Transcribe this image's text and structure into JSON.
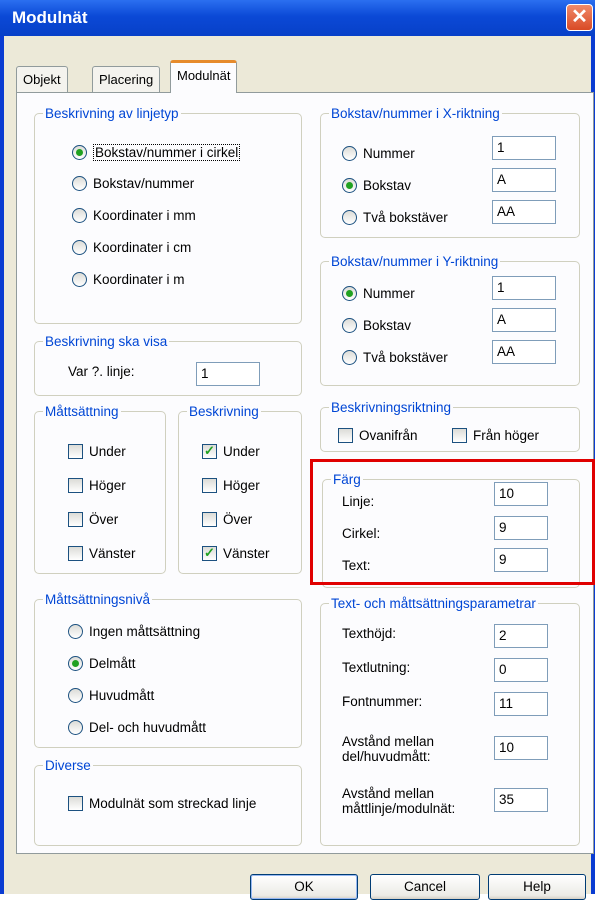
{
  "window": {
    "title": "Modulnät",
    "close_glyph": "✕"
  },
  "tabs": [
    {
      "label": "Objekt"
    },
    {
      "label": "Placering"
    },
    {
      "label": "Modulnät"
    }
  ],
  "beskrivning_linjetyp": {
    "legend": "Beskrivning av linjetyp",
    "options": [
      "Bokstav/nummer i cirkel",
      "Bokstav/nummer",
      "Koordinater i mm",
      "Koordinater i cm",
      "Koordinater i m"
    ],
    "selected": "Bokstav/nummer i cirkel"
  },
  "x_riktning": {
    "legend": "Bokstav/nummer i X-riktning",
    "options": [
      {
        "label": "Nummer",
        "value": "1"
      },
      {
        "label": "Bokstav",
        "value": "A"
      },
      {
        "label": "Två bokstäver",
        "value": "AA"
      }
    ],
    "selected": "Bokstav"
  },
  "y_riktning": {
    "legend": "Bokstav/nummer i Y-riktning",
    "options": [
      {
        "label": "Nummer",
        "value": "1"
      },
      {
        "label": "Bokstav",
        "value": "A"
      },
      {
        "label": "Två bokstäver",
        "value": "AA"
      }
    ],
    "selected": "Nummer"
  },
  "beskrivning_visa": {
    "legend": "Beskrivning ska visa",
    "label": "Var ?. linje:",
    "value": "1"
  },
  "beskrivningsriktning": {
    "legend": "Beskrivningsriktning",
    "options": [
      {
        "label": "Ovanifrån",
        "checked": false
      },
      {
        "label": "Från höger",
        "checked": false
      }
    ]
  },
  "mattsattning": {
    "legend": "Måttsättning",
    "options": [
      {
        "label": "Under",
        "checked": false
      },
      {
        "label": "Höger",
        "checked": false
      },
      {
        "label": "Över",
        "checked": false
      },
      {
        "label": "Vänster",
        "checked": false
      }
    ]
  },
  "beskrivning": {
    "legend": "Beskrivning",
    "options": [
      {
        "label": "Under",
        "checked": true
      },
      {
        "label": "Höger",
        "checked": false
      },
      {
        "label": "Över",
        "checked": false
      },
      {
        "label": "Vänster",
        "checked": true
      }
    ]
  },
  "farg": {
    "legend": "Färg",
    "fields": [
      {
        "label": "Linje:",
        "value": "10"
      },
      {
        "label": "Cirkel:",
        "value": "9"
      },
      {
        "label": "Text:",
        "value": "9"
      }
    ]
  },
  "mattsattningsniva": {
    "legend": "Måttsättningsnivå",
    "options": [
      "Ingen måttsättning",
      "Delmått",
      "Huvudmått",
      "Del- och huvudmått"
    ],
    "selected": "Delmått"
  },
  "text_parametrar": {
    "legend": "Text- och måttsättningsparametrar",
    "fields": [
      {
        "label": "Texthöjd:",
        "value": "2"
      },
      {
        "label": "Textlutning:",
        "value": "0"
      },
      {
        "label": "Fontnummer:",
        "value": "11"
      },
      {
        "label": "Avstånd mellan\ndel/huvudmått:",
        "value": "10"
      },
      {
        "label": "Avstånd mellan\nmåttlinje/modulnät:",
        "value": "35"
      }
    ]
  },
  "diverse": {
    "legend": "Diverse",
    "options": [
      {
        "label": "Modulnät som streckad linje",
        "checked": false
      }
    ]
  },
  "buttons": {
    "ok": "OK",
    "cancel": "Cancel",
    "help": "Help"
  },
  "colors": {
    "titlebar": "#0b49d6",
    "legend_text": "#0046d5",
    "highlight_box": "#e00000",
    "check_mark": "#21a121"
  }
}
